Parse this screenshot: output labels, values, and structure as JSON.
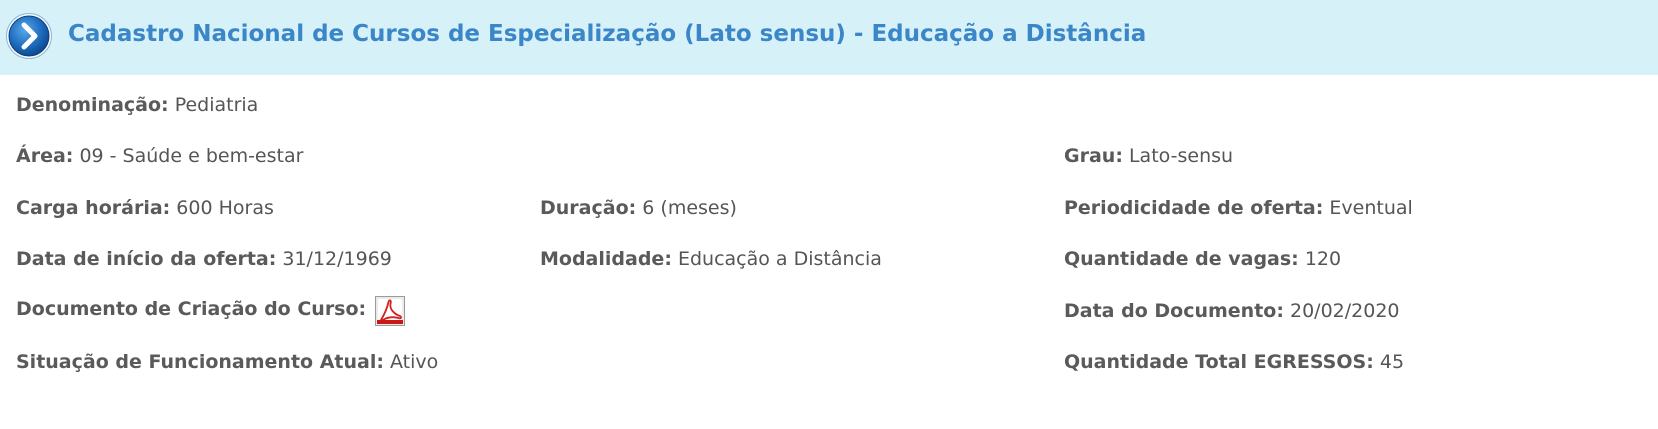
{
  "header": {
    "title": "Cadastro Nacional de Cursos de Especialização (Lato sensu) - Educação a Distância",
    "icon": "chevron-right-circle-icon",
    "background_color": "#d6f1f8",
    "title_color": "#3a86c8"
  },
  "fields": {
    "denominacao": {
      "label": "Denominação:",
      "value": "Pediatria"
    },
    "area": {
      "label": "Área:",
      "value": "09 - Saúde e bem-estar"
    },
    "grau": {
      "label": "Grau:",
      "value": "Lato-sensu"
    },
    "carga_horaria": {
      "label": "Carga horária:",
      "value": "600 Horas"
    },
    "duracao": {
      "label": "Duração:",
      "value": "6 (meses)"
    },
    "periodicidade": {
      "label": "Periodicidade de oferta:",
      "value": "Eventual"
    },
    "data_inicio": {
      "label": "Data de início da oferta:",
      "value": "31/12/1969"
    },
    "modalidade": {
      "label": "Modalidade:",
      "value": "Educação a Distância"
    },
    "quantidade_vagas": {
      "label": "Quantidade de vagas:",
      "value": "120"
    },
    "documento_criacao": {
      "label": "Documento de Criação do Curso:",
      "icon": "pdf-icon"
    },
    "data_documento": {
      "label": "Data do Documento:",
      "value": "20/02/2020"
    },
    "situacao": {
      "label": "Situação de Funcionamento Atual:",
      "value": "Ativo"
    },
    "total_egressos": {
      "label": "Quantidade Total EGRESSOS:",
      "value": "45"
    }
  }
}
